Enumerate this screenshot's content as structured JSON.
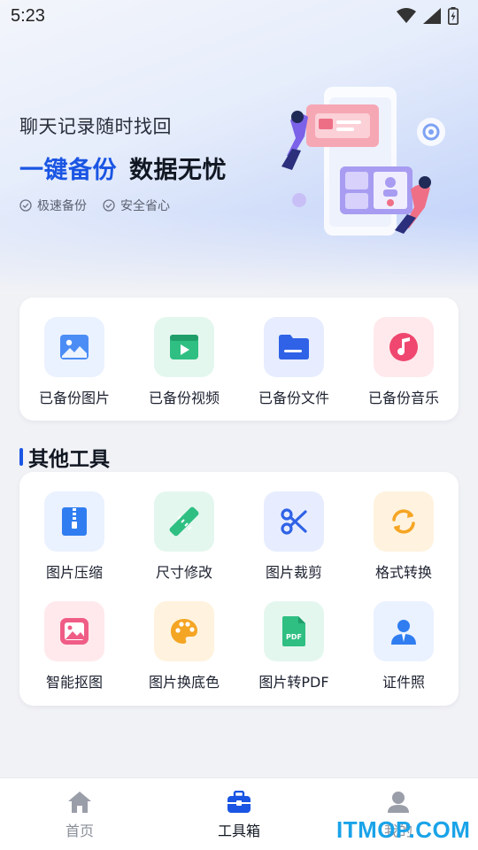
{
  "status_bar": {
    "time": "5:23"
  },
  "banner": {
    "subtitle": "聊天记录随时找回",
    "headline_accent": "一键备份",
    "headline_rest": "数据无忧",
    "features": [
      "极速备份",
      "安全省心"
    ]
  },
  "backup": {
    "items": [
      {
        "label": "已备份图片",
        "icon": "image-icon",
        "bg": "#eaf1ff"
      },
      {
        "label": "已备份视频",
        "icon": "video-icon",
        "bg": "#e4f7ef"
      },
      {
        "label": "已备份文件",
        "icon": "folder-icon",
        "bg": "#e7edff"
      },
      {
        "label": "已备份音乐",
        "icon": "music-icon",
        "bg": "#ffe9ec"
      }
    ]
  },
  "tools": {
    "title": "其他工具",
    "items": [
      {
        "label": "图片压缩",
        "icon": "zip-icon"
      },
      {
        "label": "尺寸修改",
        "icon": "ruler-icon"
      },
      {
        "label": "图片裁剪",
        "icon": "scissors-icon"
      },
      {
        "label": "格式转换",
        "icon": "convert-icon"
      },
      {
        "label": "智能抠图",
        "icon": "smart-cutout-icon"
      },
      {
        "label": "图片换底色",
        "icon": "palette-icon"
      },
      {
        "label": "图片转PDF",
        "icon": "pdf-icon"
      },
      {
        "label": "证件照",
        "icon": "id-photo-icon"
      }
    ]
  },
  "nav": {
    "items": [
      {
        "label": "首页",
        "icon": "home-icon",
        "active": false
      },
      {
        "label": "工具箱",
        "icon": "toolbox-icon",
        "active": true
      },
      {
        "label": "我的",
        "icon": "user-icon",
        "active": false
      }
    ]
  },
  "watermark": "ITMOP.COM",
  "colors": {
    "accent": "#1a55e3",
    "inactive": "#8a8f99"
  }
}
